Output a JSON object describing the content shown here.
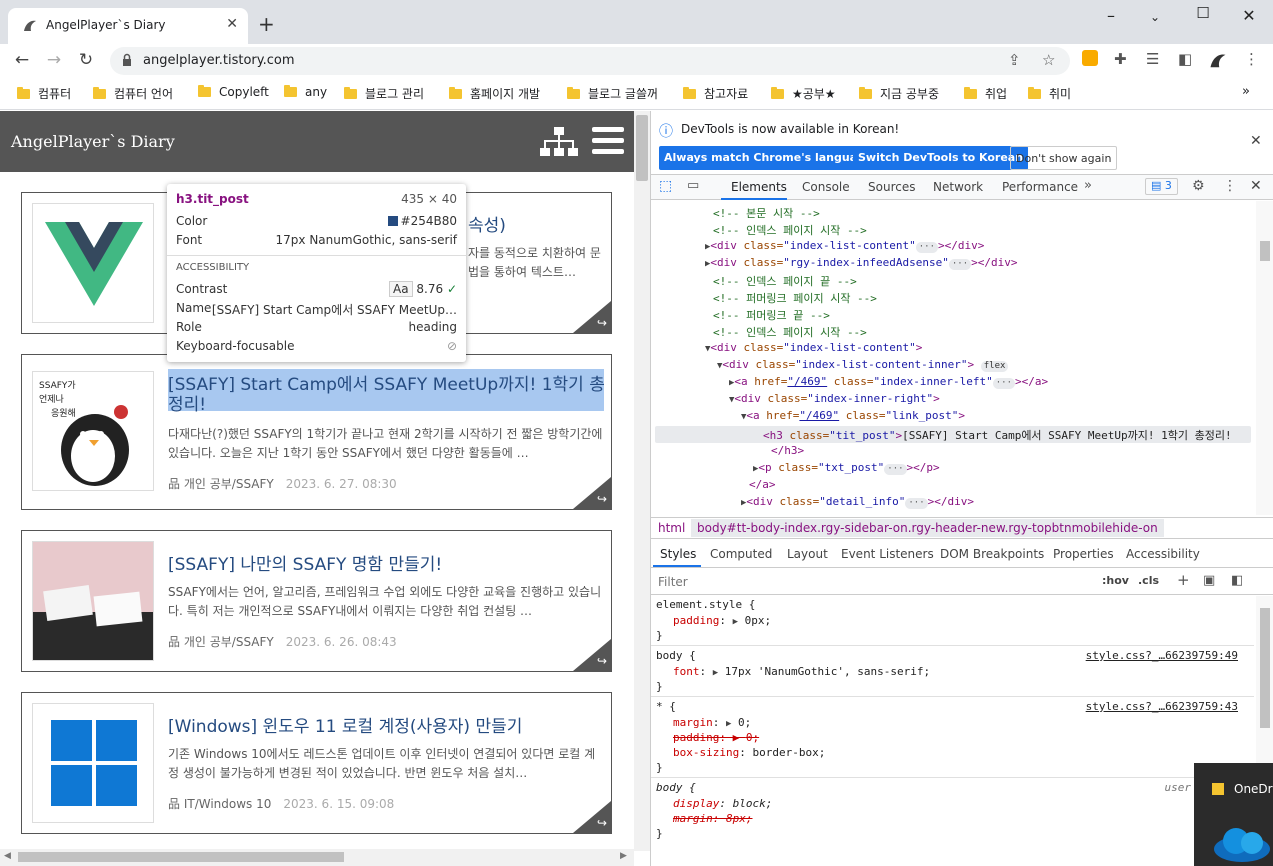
{
  "browser": {
    "tab_title": "AngelPlayer`s Diary",
    "url": "angelplayer.tistory.com",
    "bookmarks": [
      "컴퓨터",
      "컴퓨터 언어",
      "Copyleft",
      "any",
      "블로그 관리",
      "홈페이지 개발",
      "블로그 글쓸꺼",
      "참고자료",
      "★공부★",
      "지금 공부중",
      "취업",
      "취미"
    ],
    "bookmarks_more": "»"
  },
  "blog": {
    "name": "AngelPlayer`s Diary",
    "posts": [
      {
        "title": "속성)",
        "desc": "자를 동적으로 치환하여 문법을 통하여 텍스트…",
        "category": "",
        "date": ""
      },
      {
        "title": "[SSAFY] Start Camp에서 SSAFY MeetUp까지! 1학기 총정리!",
        "title_l1": "[SSAFY] Start Camp에서 SSAFY MeetUp까지! 1학기 총",
        "title_l2": "정리!",
        "desc": "다재다난(?)했던 SSAFY의 1학기가 끝나고 현재 2학기를 시작하기 전 짧은 방학기간에 있습니다. 오늘은 지난 1학기 동안 SSAFY에서 했던 다양한 활동들에 …",
        "category": "개인 공부/SSAFY",
        "date": "2023. 6. 27. 08:30"
      },
      {
        "title": "[SSAFY] 나만의 SSAFY 명함 만들기!",
        "desc": "SSAFY에서는 언어, 알고리즘, 프레임워크 수업 외에도 다양한 교육을 진행하고 있습니다. 특히 저는 개인적으로 SSAFY내에서 이뤄지는 다양한 취업 컨설팅 …",
        "category": "개인 공부/SSAFY",
        "date": "2023. 6. 26. 08:43"
      },
      {
        "title": "[Windows] 윈도우 11 로컬 계정(사용자) 만들기",
        "desc": "기존 Windows 10에서도 레드스톤 업데이트 이후 인터넷이 연결되어 있다면 로컬 계정 생성이 불가능하게 변경된 적이 있었습니다. 반면 윈도우 처음 설치…",
        "category": "IT/Windows 10",
        "date": "2023. 6. 15. 09:08"
      }
    ],
    "thumb_penguin_text": "SSAFY가 언제나 응원해"
  },
  "tooltip": {
    "selector": "h3.tit_post",
    "size": "435 × 40",
    "color_label": "Color",
    "color_value": "#254B80",
    "font_label": "Font",
    "font_value": "17px NanumGothic, sans-serif",
    "accessibility_heading": "ACCESSIBILITY",
    "contrast_label": "Contrast",
    "contrast_aa": "Aa",
    "contrast_value": "8.76",
    "name_label": "Name",
    "name_value": "[SSAFY] Start Camp에서 SSAFY MeetUp…",
    "role_label": "Role",
    "role_value": "heading",
    "kb_label": "Keyboard-focusable"
  },
  "devtools": {
    "banner_text": "DevTools is now available in Korean!",
    "btn_match": "Always match Chrome's language",
    "btn_switch": "Switch DevTools to Korean",
    "btn_dont": "Don't show again",
    "tabs": [
      "Elements",
      "Console",
      "Sources",
      "Network",
      "Performance"
    ],
    "tabs_more": "»",
    "issues_count": "3",
    "dom": [
      {
        "comment": "<!-- 본문 시작 -->"
      },
      {
        "comment": "<!-- 인덱스 페이지 시작 -->"
      },
      {
        "open": "<div ",
        "attr": "class=",
        "val": "\"index-list-content\"",
        "close": "></div>"
      },
      {
        "open": "<div ",
        "attr": "class=",
        "val": "\"rgy-index-infeedAdsense\"",
        "close": "></div>"
      },
      {
        "comment": "<!-- 인덱스 페이지 끝 -->"
      },
      {
        "comment": "<!-- 퍼머링크 페이지 시작 -->"
      },
      {
        "comment": "<!-- 퍼머링크 끝 -->"
      },
      {
        "comment": "<!-- 인덱스 페이지 시작 -->"
      },
      {
        "open": "<div ",
        "attr": "class=",
        "val": "\"index-list-content\"",
        "close": ">"
      },
      {
        "open": "<div ",
        "attr": "class=",
        "val": "\"index-list-content-inner\"",
        "close": ">",
        "badge": "flex"
      },
      {
        "open": "<a ",
        "attr": "href=",
        "val": "\"/469\"",
        "attr2": " class=",
        "val2": "\"index-inner-left\"",
        "close": "></a>"
      },
      {
        "open": "<div ",
        "attr": "class=",
        "val": "\"index-inner-right\"",
        "close": ">"
      },
      {
        "open": "<a ",
        "attr": "href=",
        "val": "\"/469\"",
        "attr2": " class=",
        "val2": "\"link_post\"",
        "close": ">"
      },
      {
        "open": "<h3 ",
        "attr": "class=",
        "val": "\"tit_post\"",
        "close": ">",
        "text": "[SSAFY] Start Camp에서 SSAFY MeetUp까지! 1학기 총정리!"
      },
      {
        "close": "</h3>"
      },
      {
        "open": "<p ",
        "attr": "class=",
        "val": "\"txt_post\"",
        "close": "></p>"
      },
      {
        "close": "</a>"
      },
      {
        "open": "<div ",
        "attr": "class=",
        "val": "\"detail_info\"",
        "close": "></div>"
      }
    ],
    "breadcrumb_html": "html",
    "breadcrumb_body": "body#tt-body-index.rgy-sidebar-on.rgy-header-new.rgy-topbtnmobilehide-on",
    "style_tabs": [
      "Styles",
      "Computed",
      "Layout",
      "Event Listeners",
      "DOM Breakpoints",
      "Properties",
      "Accessibility"
    ],
    "filter_placeholder": "Filter",
    "hov": ":hov",
    "cls": ".cls",
    "rules": [
      {
        "selector": "element.style {",
        "decls": [
          {
            "p": "padding",
            "v": "0px;"
          }
        ],
        "src": ""
      },
      {
        "selector": "body {",
        "decls": [
          {
            "p": "font",
            "v": "17px 'NanumGothic', sans-serif;"
          }
        ],
        "src": "style.css?_…66239759:49"
      },
      {
        "selector": "* {",
        "decls": [
          {
            "p": "margin",
            "v": "0;"
          },
          {
            "p": "padding",
            "v": "0;",
            "strike": true
          },
          {
            "p": "box-sizing",
            "v": "border-box;"
          }
        ],
        "src": "style.css?_…66239759:43"
      },
      {
        "selector": "body {",
        "decls": [
          {
            "p": "display",
            "v": "block;"
          },
          {
            "p": "margin",
            "v": "8px;",
            "strike": true
          }
        ],
        "src": "user agent s"
      }
    ],
    "onedrive": "OneDri"
  }
}
